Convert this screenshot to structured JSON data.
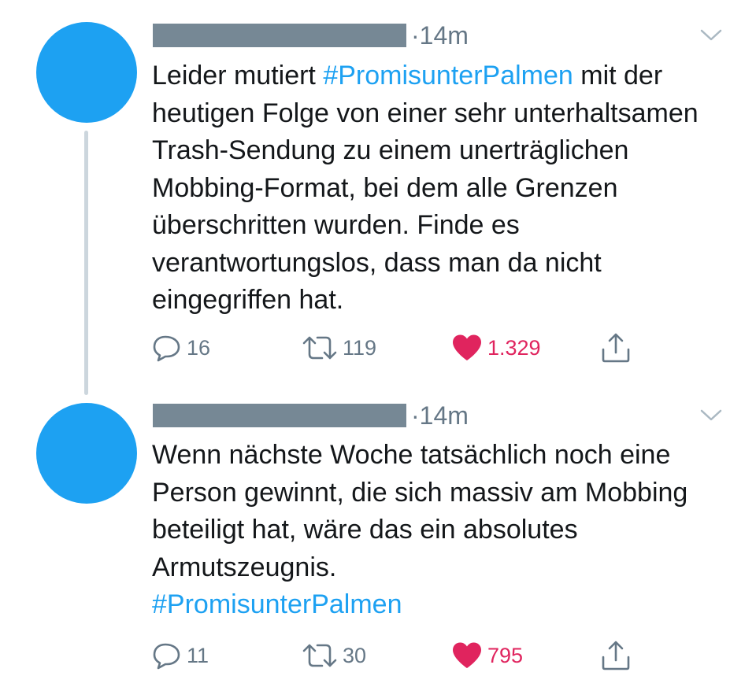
{
  "tweets": [
    {
      "time": "·14m",
      "text_pre": "Leider mutiert ",
      "hashtag": "#PromisunterPalmen",
      "text_post": " mit der heutigen Folge von einer sehr unterhaltsamen Trash-Sendung zu einem unerträglichen Mobbing-Format, bei dem alle Grenzen überschritten wurden. Finde es verantwortungslos, dass man da nicht eingegriffen hat.",
      "replies": "16",
      "retweets": "119",
      "likes": "1.329"
    },
    {
      "time": "·14m",
      "text_pre": "Wenn nächste Woche tatsächlich noch eine Person gewinnt, die sich massiv am Mobbing beteiligt hat, wäre das ein absolutes Armutszeugnis.",
      "hashtag": "#PromisunterPalmen",
      "text_post": "",
      "replies": "11",
      "retweets": "30",
      "likes": "795"
    }
  ],
  "icons": {
    "reply": "reply-icon",
    "retweet": "retweet-icon",
    "like": "heart-icon",
    "share": "share-icon",
    "menu": "chevron-down-icon"
  },
  "colors": {
    "accent": "#1da1f2",
    "like": "#e0245e",
    "muted": "#657786",
    "redaction": "#768895",
    "thread_line": "#ccd6dd"
  }
}
